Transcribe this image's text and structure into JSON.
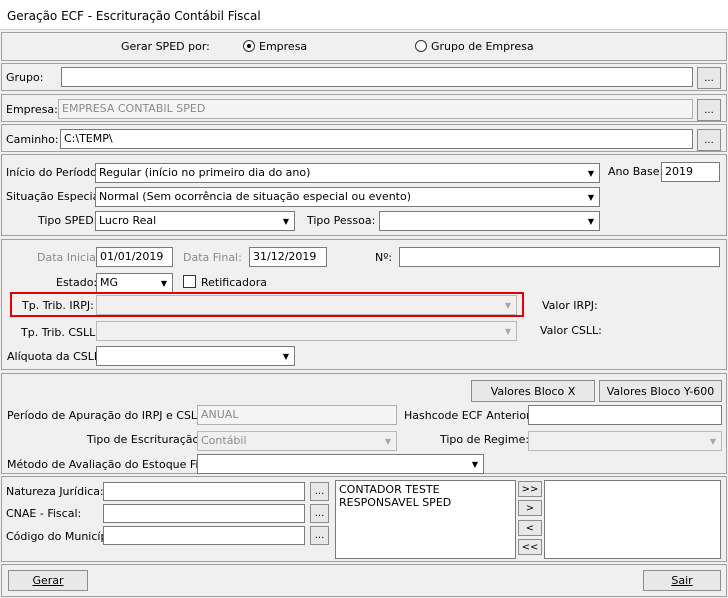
{
  "window": {
    "title": "Geração ECF - Escrituração Contábil Fiscal"
  },
  "gerar": {
    "label": "Gerar SPED por:",
    "option_empresa": "Empresa",
    "option_grupo": "Grupo de Empresa",
    "selected": "Empresa"
  },
  "grupo": {
    "label": "Grupo:",
    "value": ""
  },
  "empresa": {
    "label": "Empresa:",
    "value": "EMPRESA CONTABIL SPED"
  },
  "caminho": {
    "label": "Caminho:",
    "value": "C:\\TEMP\\"
  },
  "browse_label": "...",
  "periodo": {
    "inicio_label": "Início do Período:",
    "inicio_value": "Regular (início no primeiro dia do ano)",
    "ano_base_label": "Ano Base:",
    "ano_base_value": "2019",
    "situacao_label": "Situação Especial:",
    "situacao_value": "Normal (Sem ocorrência de situação especial ou evento)",
    "tipo_sped_label": "Tipo SPED:",
    "tipo_sped_value": "Lucro Real",
    "tipo_pessoa_label": "Tipo Pessoa:",
    "tipo_pessoa_value": ""
  },
  "dados": {
    "data_inicial_label": "Data Inicial:",
    "data_inicial_value": "01/01/2019",
    "data_final_label": "Data Final:",
    "data_final_value": "31/12/2019",
    "numero_label": "Nº:",
    "numero_value": "",
    "estado_label": "Estado:",
    "estado_value": "MG",
    "retificadora_label": "Retificadora",
    "tp_irpj_label": "Tp. Trib. IRPJ:",
    "tp_irpj_value": "",
    "valor_irpj_label": "Valor IRPJ:",
    "tp_csll_label": "Tp. Trib. CSLL:",
    "tp_csll_value": "",
    "valor_csll_label": "Valor CSLL:",
    "aliquota_label": "Alíquota da CSLL:",
    "aliquota_value": ""
  },
  "apuracao": {
    "valores_x_label": "Valores Bloco X",
    "valores_y_label": "Valores Bloco Y-600",
    "periodo_label": "Período de Apuração do IRPJ e CSLL:",
    "periodo_value": "ANUAL",
    "hashcode_label": "Hashcode ECF Anterior:",
    "hashcode_value": "",
    "tipo_escrituracao_label": "Tipo de Escrituração:",
    "tipo_escrituracao_value": "Contábil",
    "tipo_regime_label": "Tipo de Regime:",
    "tipo_regime_value": "",
    "metodo_label": "Método de Avaliação do Estoque Final:",
    "metodo_value": ""
  },
  "outros": {
    "natureza_label": "Natureza Jurídica:",
    "cnae_label": "CNAE - Fiscal:",
    "municipio_label": "Código do Município:",
    "signatarios": [
      "CONTADOR TESTE",
      "RESPONSAVEL SPED"
    ],
    "move_all_right": ">>",
    "move_right": ">",
    "move_left": "<",
    "move_all_left": "<<"
  },
  "footer": {
    "gerar_label": "Gerar",
    "sair_label": "Sair"
  }
}
